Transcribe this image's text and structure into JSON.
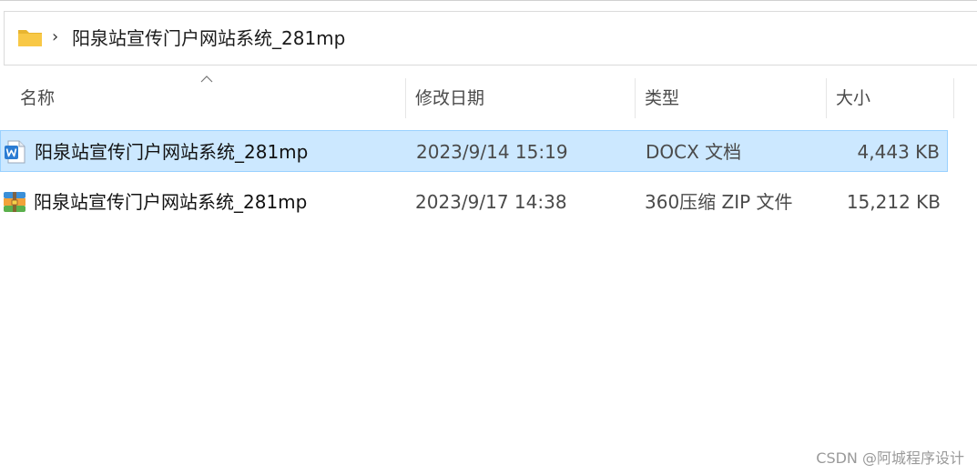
{
  "address_bar": {
    "separator": "›",
    "path": "阳泉站宣传门户网站系统_281mp"
  },
  "columns": {
    "name": "名称",
    "date": "修改日期",
    "type": "类型",
    "size": "大小"
  },
  "files": [
    {
      "name": "阳泉站宣传门户网站系统_281mp",
      "date": "2023/9/14 15:19",
      "type": "DOCX 文档",
      "size": "4,443 KB",
      "icon": "word-document-icon",
      "selected": true
    },
    {
      "name": "阳泉站宣传门户网站系统_281mp",
      "date": "2023/9/17 14:38",
      "type": "360压缩 ZIP 文件",
      "size": "15,212 KB",
      "icon": "zip-archive-icon",
      "selected": false
    }
  ],
  "watermark": "CSDN @阿城程序设计",
  "colors": {
    "selection_bg": "#cce8ff",
    "selection_border": "#99d1ff",
    "folder_yellow": "#f8c846",
    "word_blue": "#2b7cd3"
  }
}
